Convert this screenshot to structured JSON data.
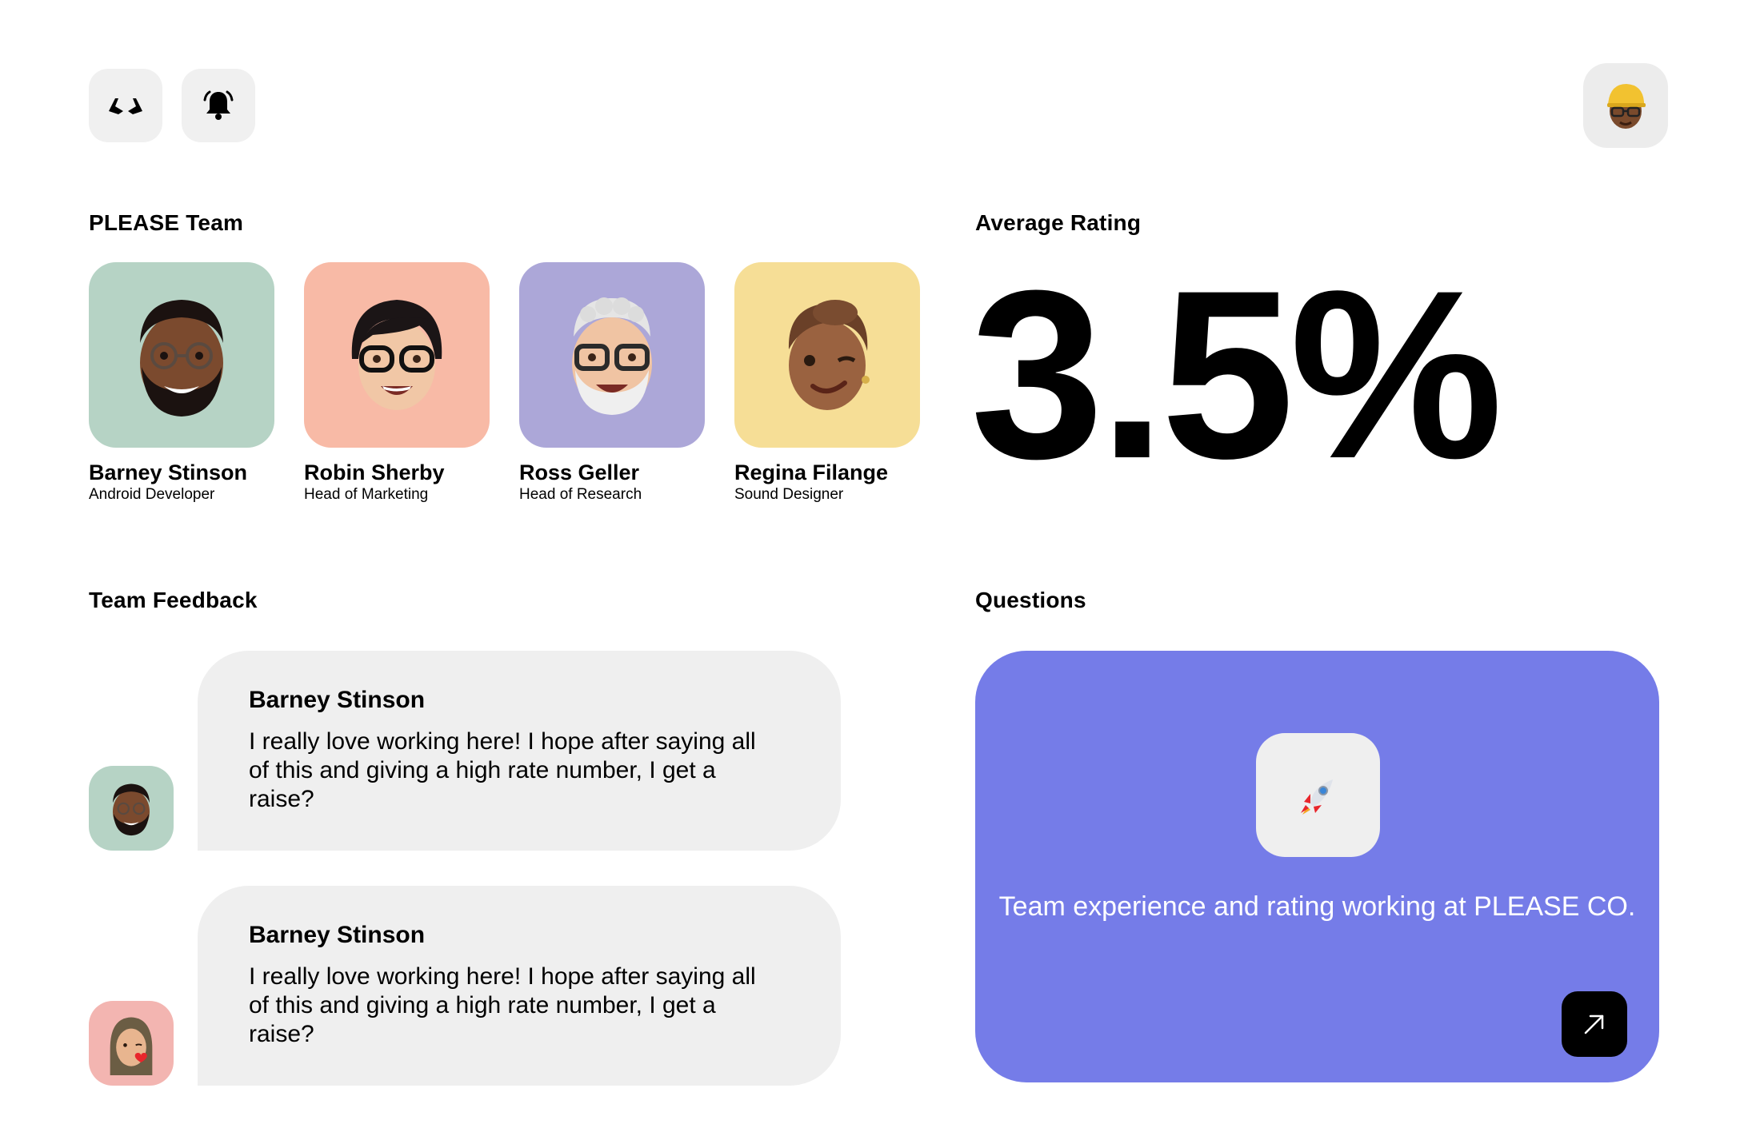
{
  "header": {
    "logo_icon": "logo-mark-icon",
    "notification_icon": "bell-icon",
    "profile_icon": "user-avatar-icon"
  },
  "team": {
    "title": "PLEASE Team",
    "members": [
      {
        "name": "Barney Stinson",
        "role": "Android Developer",
        "bg": "#b6d3c5"
      },
      {
        "name": "Robin Sherby",
        "role": "Head of Marketing",
        "bg": "#f8baa6"
      },
      {
        "name": "Ross Geller",
        "role": "Head of Research",
        "bg": "#aca7d8"
      },
      {
        "name": "Regina Filange",
        "role": "Sound Designer",
        "bg": "#f6de96"
      }
    ]
  },
  "rating": {
    "title": "Average Rating",
    "value": "3.5%"
  },
  "feedback": {
    "title": "Team Feedback",
    "items": [
      {
        "name": "Barney Stinson",
        "text": "I really love working here! I hope after saying all of this and giving a high rate number, I get a raise?",
        "avatar_bg": "#b6d3c5"
      },
      {
        "name": "Barney Stinson",
        "text": "I really love working here! I hope after saying all of this and giving a high rate number, I get a raise?",
        "avatar_bg": "#f3b5b1"
      }
    ]
  },
  "questions": {
    "title": "Questions",
    "card_text": "Team experience and rating working at PLEASE CO.",
    "card_color": "#757ce8",
    "rocket_icon": "rocket-icon",
    "arrow_icon": "arrow-up-right-icon"
  }
}
